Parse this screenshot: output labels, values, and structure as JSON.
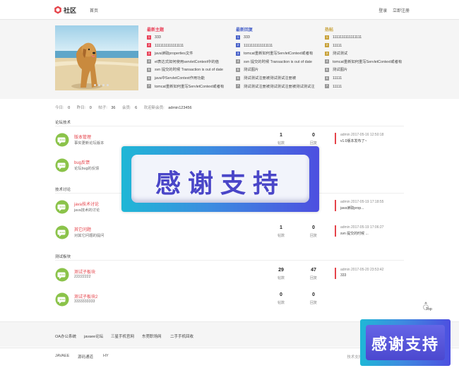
{
  "header": {
    "logo_text": "社区",
    "home": "首页",
    "login": "登录",
    "register": "立即注册"
  },
  "columns": [
    {
      "title": "最新主题",
      "title_color": "#e9435a",
      "items": [
        {
          "n": "1",
          "text": "333"
        },
        {
          "n": "2",
          "text": "1111111111111111"
        },
        {
          "n": "3",
          "text": "java读取properties文件"
        },
        {
          "n": "4",
          "text": "el表达式如何使用servletContext中的值"
        },
        {
          "n": "5",
          "text": "svn 提交的时候 Transaction is out of date"
        },
        {
          "n": "6",
          "text": "java中ServletContext作用功能"
        },
        {
          "n": "7",
          "text": "tomcat重新如何重写ServletContext或者有"
        }
      ]
    },
    {
      "title": "最新回复",
      "title_color": "#4a63c9",
      "items": [
        {
          "n": "1",
          "text": "333"
        },
        {
          "n": "2",
          "text": "1111111111111111"
        },
        {
          "n": "3",
          "text": "tomcat重新如何重写ServletContext或者有"
        },
        {
          "n": "4",
          "text": "svn 提交的时候 Transaction is out of date"
        },
        {
          "n": "5",
          "text": "测试图片"
        },
        {
          "n": "6",
          "text": "测试测试注册被测试测试注册被"
        },
        {
          "n": "7",
          "text": "测试测试注册被测试测试注册被测试测试注"
        }
      ]
    },
    {
      "title": "热帖",
      "title_color": "#c8a23a",
      "items": [
        {
          "n": "1",
          "text": "1111111111111111"
        },
        {
          "n": "2",
          "text": "11111"
        },
        {
          "n": "3",
          "text": "测试测试"
        },
        {
          "n": "4",
          "text": "tomcat重新如何重写ServletContext或者有"
        },
        {
          "n": "5",
          "text": "测试图片"
        },
        {
          "n": "6",
          "text": "11111"
        },
        {
          "n": "7",
          "text": "11111"
        }
      ]
    }
  ],
  "stats": {
    "today_label": "今日:",
    "today": "0",
    "yesterday_label": "昨日:",
    "yesterday": "0",
    "posts_label": "帖子:",
    "posts": "36",
    "members_label": "会员:",
    "members": "6",
    "welcome_label": "欢迎新会员:",
    "newest": "admin123456"
  },
  "sections": [
    {
      "title": "论坛技术",
      "forums": [
        {
          "name": "版本管理",
          "desc": "事实更新论坛版本",
          "threads": "1",
          "threads_label": "帖数",
          "replies": "0",
          "replies_label": "回复",
          "last_meta": "admin 2017-05-16 12:50:18",
          "last_title": "v1.0版本发布了~"
        },
        {
          "name": "bug反馈",
          "desc": "论坛bug的反馈",
          "threads": "",
          "threads_label": "",
          "replies": "",
          "replies_label": "",
          "last_meta": "",
          "last_title": ""
        }
      ]
    },
    {
      "title": "技术讨论",
      "forums": [
        {
          "name": "java技术讨论",
          "desc": "java技术的讨论",
          "threads": "",
          "threads_label": "",
          "replies": "",
          "replies_label": "",
          "last_meta": "admin 2017-05-19 17:18:55",
          "last_title": "java读取prop..."
        },
        {
          "name": "其它问题",
          "desc": "对其它问题的提问",
          "threads": "1",
          "threads_label": "帖数",
          "replies": "0",
          "replies_label": "回复",
          "last_meta": "admin 2017-05-19 17:06:27",
          "last_title": "svn 提交的时候 ..."
        }
      ]
    },
    {
      "title": "测试板块",
      "forums": [
        {
          "name": "测试子板块",
          "desc": "22222222",
          "threads": "29",
          "threads_label": "帖数",
          "replies": "47",
          "replies_label": "回复",
          "last_meta": "admin 2017-05-20 23:53:42",
          "last_title": "333"
        },
        {
          "name": "测试子板块2",
          "desc": "3333333333",
          "threads": "0",
          "threads_label": "帖数",
          "replies": "0",
          "replies_label": "回复",
          "last_meta": "",
          "last_title": ""
        }
      ]
    }
  ],
  "friend_links": [
    "OA办公系统",
    "javaee论坛",
    "三星手机官网",
    "东莞职场网",
    "二手手机回收"
  ],
  "footer": {
    "links": [
      "JAVAEE",
      "源码通道",
      "HY"
    ],
    "right": "技术支持 WATE"
  },
  "top_label": "Top",
  "overlay_text": "感谢支持",
  "overlay_small_text": "感谢支持",
  "colors": {
    "accent_red": "#e5434a",
    "badge_blue": "#4a63c9",
    "badge_gold": "#c8a23a",
    "forum_icon_green": "#8bc34a"
  }
}
